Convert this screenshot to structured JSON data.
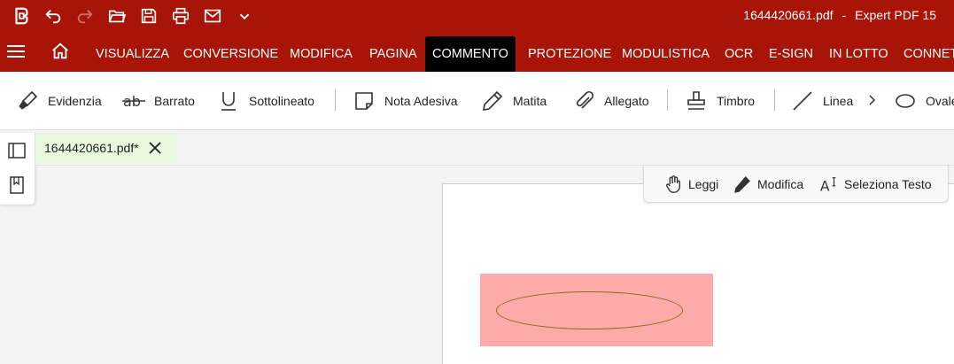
{
  "app": {
    "file_name": "1644420661.pdf",
    "separator": "-",
    "app_name": "Expert PDF 15"
  },
  "quick_access": [
    "app-logo-icon",
    "undo-icon",
    "redo-icon",
    "open-folder-icon",
    "save-icon",
    "print-icon",
    "mail-icon",
    "chevron-down-icon"
  ],
  "menu": {
    "items": [
      "VISUALIZZA",
      "CONVERSIONE",
      "MODIFICA",
      "PAGINA",
      "COMMENTO",
      "PROTEZIONE",
      "MODULISTICA",
      "OCR",
      "E-SIGN",
      "IN LOTTO",
      "CONNETTI"
    ],
    "active": "COMMENTO"
  },
  "ribbon": {
    "highlight": "Evidenzia",
    "strikeout": "Barrato",
    "underline": "Sottolineato",
    "sticky_note": "Nota Adesiva",
    "pencil": "Matita",
    "attachment": "Allegato",
    "stamp": "Timbro",
    "line": "Linea",
    "oval": "Ovale"
  },
  "tab": {
    "label": "1644420661.pdf*"
  },
  "modes": {
    "read": "Leggi",
    "edit": "Modifica",
    "select_text": "Seleziona Testo"
  },
  "colors": {
    "brand": "#a81508",
    "active_tab": "#000000",
    "doc_tab": "#e8f7de",
    "annotation_fill": "#ffaaaa",
    "annotation_stroke": "#8a6a1e"
  }
}
